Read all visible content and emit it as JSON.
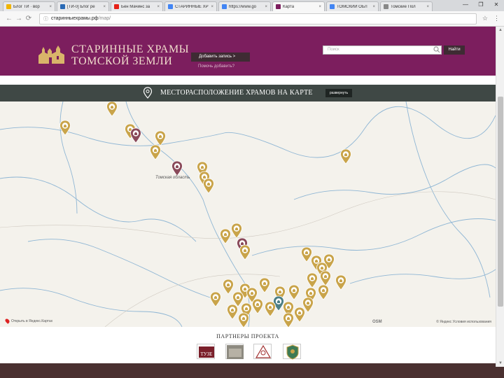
{
  "browser": {
    "tabs": [
      {
        "title": "Блог ТИ · вор",
        "fav": "#f0b400",
        "active": false
      },
      {
        "title": "[ТИ-0] Блог ре",
        "fav": "#2a6ab5",
        "active": false
      },
      {
        "title": "Бен Мачинс за",
        "fav": "#e62117",
        "active": false
      },
      {
        "title": "СТАРИННЫЕ ХР",
        "fav": "#4285f4",
        "active": false
      },
      {
        "title": "https://www.go",
        "fav": "#4285f4",
        "active": false
      },
      {
        "title": "Карта",
        "fav": "#7c1e5e",
        "active": true
      },
      {
        "title": "ТОМСКИЙ ОБЛ",
        "fav": "#4285f4",
        "active": false
      },
      {
        "title": "Томские Пол",
        "fav": "#888888",
        "active": false
      }
    ],
    "url_host": "старинныехрамы.рф",
    "url_path": "/map/",
    "window_controls": [
      "—",
      "❐",
      "✕"
    ]
  },
  "header": {
    "logo_line1": "СТАРИННЫЕ ХРАМЫ",
    "logo_line2": "ТОМСКОЙ ЗЕМЛИ",
    "add_record_label": "Добавить запись >",
    "how_add_label": "Помочь добавить?",
    "search_placeholder": "Поиск",
    "search_button": "Найти"
  },
  "section": {
    "title": "МЕСТОРАСПОЛОЖЕНИЕ ХРАМОВ НА КАРТЕ",
    "expand_label": "развернуть"
  },
  "map": {
    "city_label": "Томская область",
    "bottom_left": "Открыть в Яндекс.Картах",
    "attribution": "© Яндекс Условия использования",
    "logo": "OSM",
    "marker_gold": "#c9a44a",
    "marker_brown": "#8a4a5a",
    "marker_teal": "#4c7f86"
  },
  "partners": {
    "title": "ПАРТНЕРЫ ПРОЕКТА",
    "items": [
      "ТУЗЕ",
      "photo",
      "ТГАСУ",
      "emblem"
    ]
  }
}
